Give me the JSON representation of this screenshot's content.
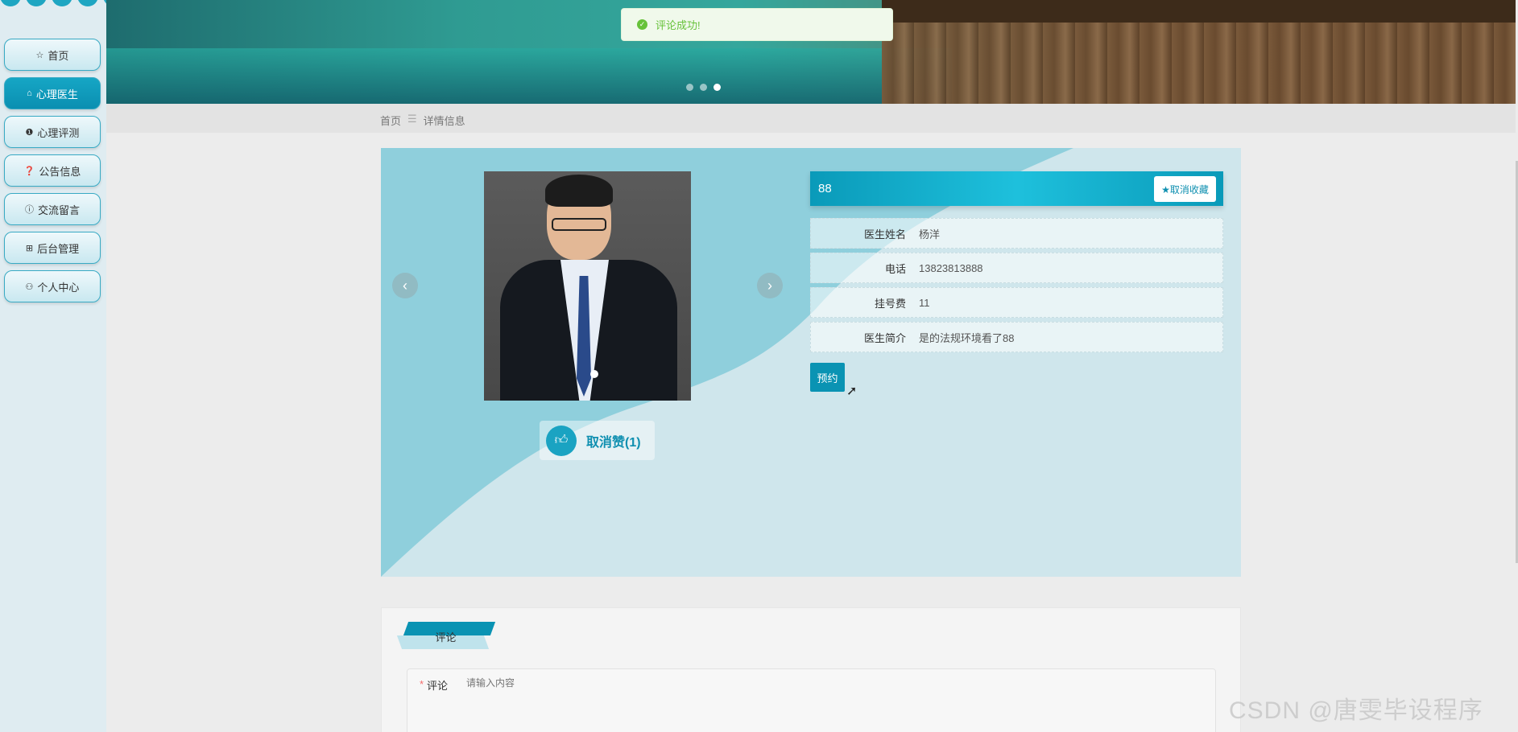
{
  "nav": {
    "items": [
      {
        "label": "首页",
        "icon": "star-icon",
        "glyph": "☆"
      },
      {
        "label": "心理医生",
        "icon": "home-icon",
        "glyph": "⌂"
      },
      {
        "label": "心理评测",
        "icon": "alert-icon",
        "glyph": "❶"
      },
      {
        "label": "公告信息",
        "icon": "help-icon",
        "glyph": "❓"
      },
      {
        "label": "交流留言",
        "icon": "info-icon",
        "glyph": "ⓘ"
      },
      {
        "label": "后台管理",
        "icon": "gift-icon",
        "glyph": "⊞"
      },
      {
        "label": "个人中心",
        "icon": "user-icon",
        "glyph": "⚇"
      }
    ],
    "active_index": 1
  },
  "toast": {
    "message": "评论成功!"
  },
  "carousel": {
    "dot_count": 3,
    "active_dot": 3
  },
  "breadcrumb": {
    "home": "首页",
    "separator": "☰",
    "current": "详情信息"
  },
  "detail": {
    "title": "88",
    "favorite_button": "★取消收藏",
    "like_button": "取消赞(1)",
    "fields": [
      {
        "label": "医生姓名",
        "value": "杨洋"
      },
      {
        "label": "电话",
        "value": "13823813888"
      },
      {
        "label": "挂号费",
        "value": "11"
      },
      {
        "label": "医生简介",
        "value": "是的法规环境看了88"
      }
    ],
    "book_button": "预约",
    "prev_arrow": "‹",
    "next_arrow": "›"
  },
  "comment": {
    "tab_label": "评论",
    "field_label": "评论",
    "required_mark": "*",
    "placeholder": "请输入内容"
  },
  "watermark": "CSDN @唐雯毕设程序"
}
